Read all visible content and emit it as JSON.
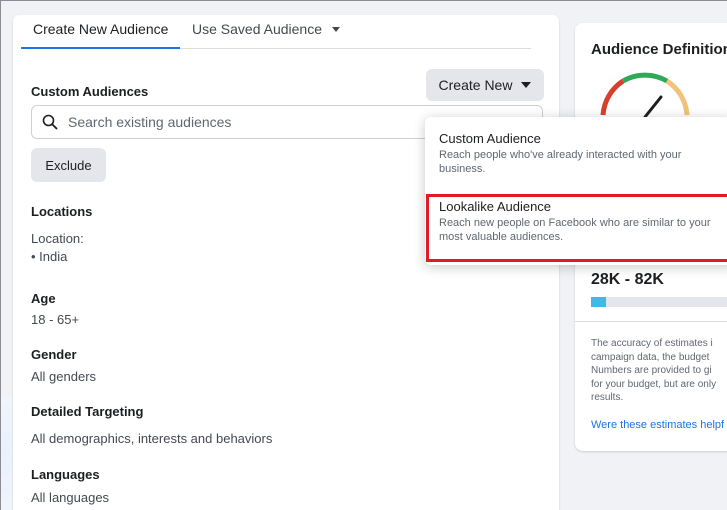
{
  "tabs": {
    "create_new": "Create New Audience",
    "use_saved": "Use Saved Audience"
  },
  "custom_audiences": {
    "title": "Custom Audiences",
    "create_button": "Create New",
    "search_placeholder": "Search existing audiences",
    "exclude_button": "Exclude"
  },
  "locations": {
    "title": "Locations",
    "label": "Location:",
    "item": "• India"
  },
  "age": {
    "title": "Age",
    "value": "18 - 65+"
  },
  "gender": {
    "title": "Gender",
    "value": "All genders"
  },
  "detailed_targeting": {
    "title": "Detailed Targeting",
    "value": "All demographics, interests and behaviors"
  },
  "languages": {
    "title": "Languages",
    "value": "All languages"
  },
  "dropdown": {
    "items": [
      {
        "title": "Custom Audience",
        "desc": "Reach people who've already interacted with your business."
      },
      {
        "title": "Lookalike Audience",
        "desc": "Reach new people on Facebook who are similar to your most valuable audiences."
      }
    ]
  },
  "audience_definition": {
    "title": "Audience Definition",
    "reach_value": "28K - 82K",
    "estimate_text": "The accuracy of estimates i\ncampaign data, the budget \nNumbers are provided to gi\nfor your budget, but are only\nresults.",
    "estimate_link": "Were these estimates helpf"
  },
  "colors": {
    "accent": "#1b74e4",
    "highlight": "#e01b24",
    "reach_bar": "#43b8e6"
  }
}
